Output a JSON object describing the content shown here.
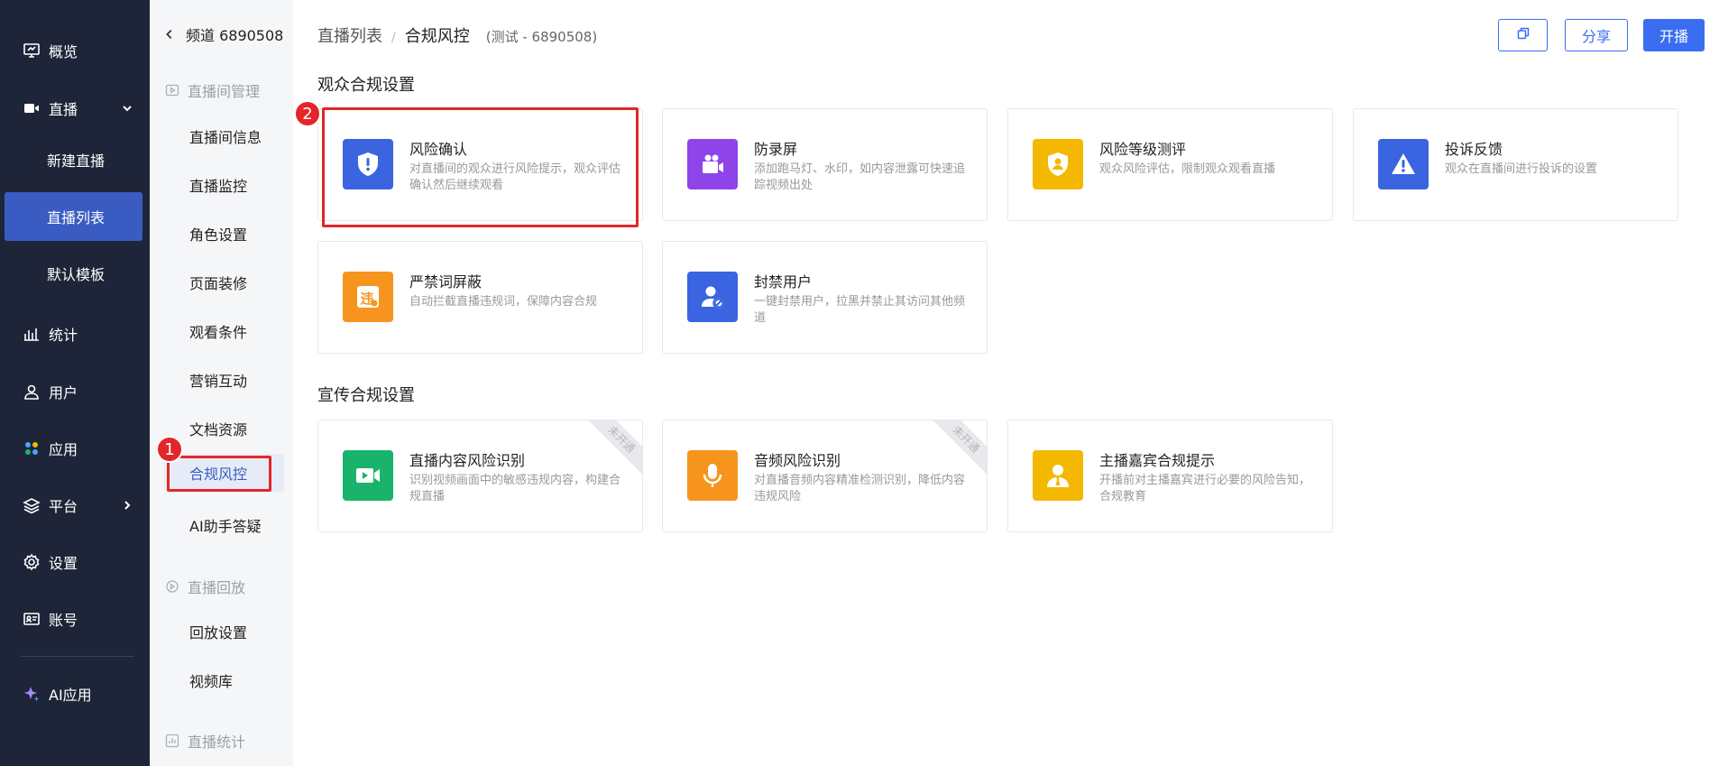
{
  "nav": {
    "items": [
      {
        "label": "概览",
        "icon": "monitor-icon"
      },
      {
        "label": "直播",
        "icon": "video-icon"
      },
      {
        "label": "统计",
        "icon": "bar-chart-icon"
      },
      {
        "label": "用户",
        "icon": "user-icon"
      },
      {
        "label": "应用",
        "icon": "apps-icon"
      },
      {
        "label": "平台",
        "icon": "layers-icon"
      },
      {
        "label": "设置",
        "icon": "gear-icon"
      },
      {
        "label": "账号",
        "icon": "id-card-icon"
      },
      {
        "label": "AI应用",
        "icon": "sparkle-icon"
      }
    ],
    "live_sub": [
      {
        "label": "新建直播"
      },
      {
        "label": "直播列表"
      },
      {
        "label": "默认模板"
      }
    ]
  },
  "submenu": {
    "back_label": "频道 6890508",
    "groups": [
      {
        "label": "直播间管理"
      },
      {
        "label": "直播回放"
      },
      {
        "label": "直播统计"
      }
    ],
    "room_items": [
      "直播间信息",
      "直播监控",
      "角色设置",
      "页面装修",
      "观看条件",
      "营销互动",
      "文档资源",
      "合规风控",
      "AI助手答疑"
    ],
    "replay_items": [
      "回放设置",
      "视频库"
    ]
  },
  "topbar": {
    "crumb_parent": "直播列表",
    "crumb_sep": "/",
    "crumb_current": "合规风控",
    "crumb_channel": "(测试 - 6890508)",
    "share_label": "分享",
    "live_label": "开播"
  },
  "sections": {
    "audience_title": "观众合规设置",
    "promo_title": "宣传合规设置"
  },
  "audience_cards": [
    {
      "title": "风险确认",
      "desc": "对直播间的观众进行风险提示，观众评估确认然后继续观看",
      "icon": "shield-alert-icon",
      "color": "#3b64e0"
    },
    {
      "title": "防录屏",
      "desc": "添加跑马灯、水印，如内容泄露可快速追踪视频出处",
      "icon": "camera-icon",
      "color": "#8e44e8"
    },
    {
      "title": "风险等级测评",
      "desc": "观众风险评估，限制观众观看直播",
      "icon": "shield-user-icon",
      "color": "#f5b800"
    },
    {
      "title": "投诉反馈",
      "desc": "观众在直播间进行投诉的设置",
      "icon": "warning-icon",
      "color": "#3b64e0"
    },
    {
      "title": "严禁词屏蔽",
      "desc": "自动拦截直播违规词，保障内容合规",
      "icon": "forbidden-word-icon",
      "color": "#f7941d"
    },
    {
      "title": "封禁用户",
      "desc": "一键封禁用户，拉黑并禁止其访问其他频道",
      "icon": "ban-user-icon",
      "color": "#3b64e0"
    }
  ],
  "promo_cards": [
    {
      "title": "直播内容风险识别",
      "desc": "识别视频画面中的敏感违规内容，构建合规直播",
      "icon": "video-camera-icon",
      "color": "#19b36b",
      "ribbon": "未开通"
    },
    {
      "title": "音频风险识别",
      "desc": "对直播音频内容精准检测识别，降低内容违规风险",
      "icon": "microphone-icon",
      "color": "#f7941d",
      "ribbon": "未开通"
    },
    {
      "title": "主播嘉宾合规提示",
      "desc": "开播前对主播嘉宾进行必要的风险告知，合规教育",
      "icon": "anchor-user-icon",
      "color": "#f5b800"
    }
  ],
  "annotations": {
    "badge_one": "1",
    "badge_two": "2"
  }
}
